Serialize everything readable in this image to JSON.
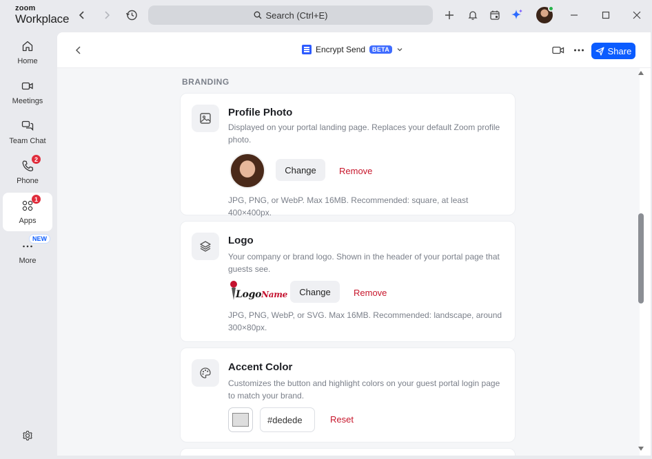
{
  "brand": {
    "line1": "zoom",
    "line2": "Workplace"
  },
  "search": {
    "placeholder": "Search (Ctrl+E)"
  },
  "sidebar": {
    "items": [
      {
        "label": "Home",
        "icon": "home-icon"
      },
      {
        "label": "Meetings",
        "icon": "video-icon"
      },
      {
        "label": "Team Chat",
        "icon": "chat-icon"
      },
      {
        "label": "Phone",
        "icon": "phone-icon",
        "badge": "2"
      },
      {
        "label": "Apps",
        "icon": "apps-icon",
        "badge": "1",
        "active": true
      },
      {
        "label": "More",
        "icon": "more-icon",
        "tag": "NEW"
      }
    ]
  },
  "header": {
    "app_name": "Encrypt Send",
    "beta": "BETA",
    "share_label": "Share"
  },
  "branding": {
    "section_label": "BRANDING",
    "profile_photo": {
      "title": "Profile Photo",
      "description": "Displayed on your portal landing page. Replaces your default Zoom profile photo.",
      "change_label": "Change",
      "remove_label": "Remove",
      "hint": "JPG, PNG, or WebP. Max 16MB. Recommended: square, at least 400×400px."
    },
    "logo": {
      "title": "Logo",
      "description": "Your company or brand logo. Shown in the header of your portal page that guests see.",
      "logo_word": "Logo",
      "logo_name": "Name",
      "change_label": "Change",
      "remove_label": "Remove",
      "hint": "JPG, PNG, WebP, or SVG. Max 16MB. Recommended: landscape, around 300×80px."
    },
    "accent_color": {
      "title": "Accent Color",
      "description": "Customizes the button and highlight colors on your guest portal login page to match your brand.",
      "value": "#dedede",
      "reset_label": "Reset"
    }
  },
  "colors": {
    "accent": "#0b5cff",
    "danger": "#c7162b",
    "badge": "#e02d3c"
  }
}
